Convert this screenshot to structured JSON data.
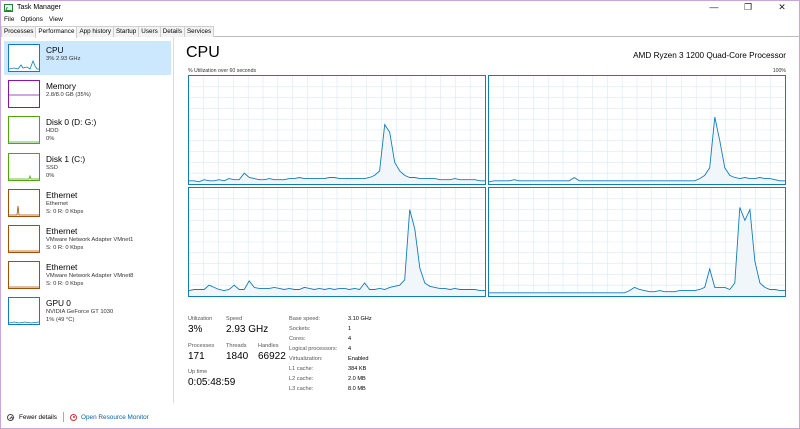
{
  "window": {
    "title": "Task Manager",
    "controls": {
      "minimize": "—",
      "maximize": "❐",
      "close": "✕"
    }
  },
  "menu": [
    "File",
    "Options",
    "View"
  ],
  "tabs": [
    {
      "label": "Processes",
      "active": false
    },
    {
      "label": "Performance",
      "active": true
    },
    {
      "label": "App history",
      "active": false
    },
    {
      "label": "Startup",
      "active": false
    },
    {
      "label": "Users",
      "active": false
    },
    {
      "label": "Details",
      "active": false
    },
    {
      "label": "Services",
      "active": false
    }
  ],
  "sidebar": [
    {
      "name": "CPU",
      "lines": [
        "3%  2.93 GHz"
      ],
      "selected": true,
      "color": "#117dbb"
    },
    {
      "name": "Memory",
      "lines": [
        "2.8/8.0 GB (35%)"
      ],
      "selected": false,
      "color": "#8b12ae"
    },
    {
      "name": "Disk 0 (D: G:)",
      "lines": [
        "HDD",
        "0%"
      ],
      "selected": false,
      "color": "#4da60c"
    },
    {
      "name": "Disk 1 (C:)",
      "lines": [
        "SSD",
        "0%"
      ],
      "selected": false,
      "color": "#4da60c"
    },
    {
      "name": "Ethernet",
      "lines": [
        "Ethernet",
        "S: 0 R: 0 Kbps"
      ],
      "selected": false,
      "color": "#a74f01"
    },
    {
      "name": "Ethernet",
      "lines": [
        "VMware Network Adapter VMnet1",
        "S: 0 R: 0 Kbps"
      ],
      "selected": false,
      "color": "#a74f01"
    },
    {
      "name": "Ethernet",
      "lines": [
        "VMware Network Adapter VMnet8",
        "S: 0 R: 0 Kbps"
      ],
      "selected": false,
      "color": "#a74f01"
    },
    {
      "name": "GPU 0",
      "lines": [
        "NVIDIA GeForce GT 1030",
        "1% (49 °C)"
      ],
      "selected": false,
      "color": "#117dbb"
    }
  ],
  "main": {
    "title": "CPU",
    "model": "AMD Ryzen 3 1200 Quad-Core Processor",
    "utilization_label": "% Utilization over 60 seconds",
    "utilization_max": "100%",
    "graph_color": "#117dbb",
    "core_graphs": [
      [
        3,
        3,
        2,
        4,
        3,
        3,
        4,
        3,
        5,
        4,
        4,
        10,
        6,
        5,
        4,
        4,
        5,
        4,
        4,
        4,
        5,
        5,
        6,
        5,
        5,
        5,
        5,
        5,
        6,
        6,
        5,
        5,
        5,
        5,
        5,
        5,
        6,
        8,
        12,
        55,
        48,
        20,
        12,
        8,
        6,
        6,
        5,
        5,
        5,
        5,
        4,
        4,
        4,
        5,
        4,
        4,
        4,
        4,
        3,
        3
      ],
      [
        2,
        3,
        3,
        3,
        3,
        4,
        3,
        3,
        3,
        3,
        3,
        3,
        3,
        3,
        3,
        3,
        3,
        6,
        3,
        3,
        3,
        3,
        3,
        3,
        3,
        3,
        3,
        3,
        3,
        3,
        3,
        3,
        3,
        3,
        3,
        3,
        3,
        3,
        3,
        3,
        3,
        3,
        5,
        8,
        15,
        62,
        40,
        15,
        8,
        6,
        5,
        6,
        5,
        5,
        6,
        5,
        5,
        4,
        3,
        3
      ],
      [
        5,
        6,
        6,
        6,
        10,
        8,
        6,
        5,
        6,
        10,
        6,
        6,
        14,
        8,
        7,
        7,
        7,
        8,
        7,
        6,
        7,
        6,
        6,
        8,
        7,
        6,
        7,
        6,
        7,
        6,
        7,
        7,
        6,
        7,
        6,
        12,
        6,
        6,
        7,
        6,
        8,
        9,
        10,
        15,
        80,
        62,
        26,
        12,
        9,
        8,
        7,
        7,
        6,
        7,
        6,
        6,
        6,
        6,
        5,
        5
      ],
      [
        3,
        3,
        3,
        3,
        3,
        3,
        3,
        3,
        3,
        3,
        3,
        3,
        3,
        3,
        3,
        3,
        3,
        3,
        3,
        3,
        3,
        3,
        3,
        3,
        3,
        3,
        3,
        3,
        5,
        8,
        6,
        5,
        4,
        4,
        5,
        4,
        4,
        4,
        5,
        5,
        5,
        5,
        6,
        8,
        25,
        8,
        8,
        8,
        6,
        12,
        82,
        70,
        80,
        32,
        12,
        8,
        6,
        6,
        5,
        5
      ]
    ]
  },
  "stats": {
    "utilization": {
      "label": "Utilization",
      "value": "3%"
    },
    "speed": {
      "label": "Speed",
      "value": "2.93 GHz"
    },
    "processes": {
      "label": "Processes",
      "value": "171"
    },
    "threads": {
      "label": "Threads",
      "value": "1840"
    },
    "handles": {
      "label": "Handles",
      "value": "66922"
    },
    "uptime": {
      "label": "Up time",
      "value": "0:05:48:59"
    }
  },
  "specs": [
    {
      "k": "Base speed:",
      "v": "3.10 GHz"
    },
    {
      "k": "Sockets:",
      "v": "1"
    },
    {
      "k": "Cores:",
      "v": "4"
    },
    {
      "k": "Logical processors:",
      "v": "4"
    },
    {
      "k": "Virtualization:",
      "v": "Enabled"
    },
    {
      "k": "L1 cache:",
      "v": "384 KB"
    },
    {
      "k": "L2 cache:",
      "v": "2.0 MB"
    },
    {
      "k": "L3 cache:",
      "v": "8.0 MB"
    }
  ],
  "footer": {
    "fewer_details": "Fewer details",
    "open_resource_monitor": "Open Resource Monitor"
  }
}
